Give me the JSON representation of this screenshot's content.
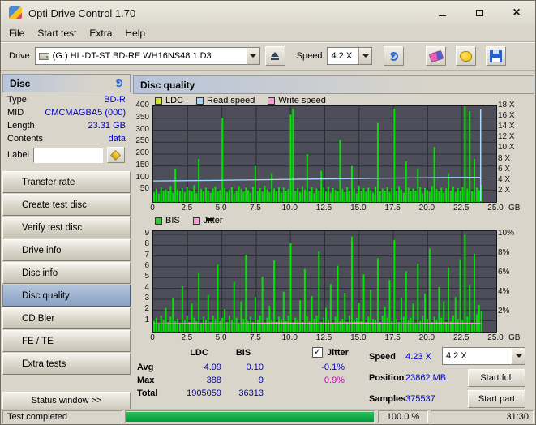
{
  "window": {
    "title": "Opti Drive Control 1.70"
  },
  "menu": {
    "items": [
      "File",
      "Start test",
      "Extra",
      "Help"
    ]
  },
  "toolbar": {
    "drive_label": "Drive",
    "drive_value": "(G:)  HL-DT-ST BD-RE  WH16NS48 1.D3",
    "speed_label": "Speed",
    "speed_value": "4.2 X"
  },
  "sidebar": {
    "panel_title": "Disc",
    "info": [
      {
        "label": "Type",
        "value": "BD-R"
      },
      {
        "label": "MID",
        "value": "CMCMAGBA5 (000)"
      },
      {
        "label": "Length",
        "value": "23.31 GB"
      },
      {
        "label": "Contents",
        "value": "data"
      }
    ],
    "label_row": {
      "label": "Label",
      "value": ""
    },
    "buttons": [
      {
        "id": "transfer-rate",
        "label": "Transfer rate"
      },
      {
        "id": "create-test-disc",
        "label": "Create test disc"
      },
      {
        "id": "verify-test-disc",
        "label": "Verify test disc"
      },
      {
        "id": "drive-info",
        "label": "Drive info"
      },
      {
        "id": "disc-info",
        "label": "Disc info"
      },
      {
        "id": "disc-quality",
        "label": "Disc quality",
        "selected": true
      },
      {
        "id": "cd-bler",
        "label": "CD Bler"
      },
      {
        "id": "fe-te",
        "label": "FE / TE"
      },
      {
        "id": "extra-tests",
        "label": "Extra tests"
      }
    ],
    "status_button": "Status window >>"
  },
  "main": {
    "panel_title": "Disc quality"
  },
  "chart_data": [
    {
      "type": "bar",
      "name": "ldc-and-speed",
      "legend": [
        {
          "label": "LDC",
          "color": "#c9e636"
        },
        {
          "label": "Read speed",
          "color": "#a6d8ff"
        },
        {
          "label": "Write speed",
          "color": "#ff9ad5"
        }
      ],
      "x_axis": {
        "ticks": [
          "0",
          "2.5",
          "5.0",
          "7.5",
          "10.0",
          "12.5",
          "15.0",
          "17.5",
          "20.0",
          "22.5",
          "25.0"
        ],
        "unit": "GB",
        "max_gb": 25,
        "tested_range_gb": 23.86
      },
      "y_left": {
        "ticks": [
          400,
          350,
          300,
          250,
          200,
          150,
          100,
          50
        ],
        "max": 400
      },
      "y_right": {
        "ticks": [
          {
            "v": 18,
            "label": "18 X"
          },
          {
            "v": 16,
            "label": "16 X"
          },
          {
            "v": 14,
            "label": "14 X"
          },
          {
            "v": 12,
            "label": "12 X"
          },
          {
            "v": 10,
            "label": "10 X"
          },
          {
            "v": 8,
            "label": "8 X"
          },
          {
            "v": 6,
            "label": "6 X"
          },
          {
            "v": 4,
            "label": "4 X"
          },
          {
            "v": 2,
            "label": "2 X"
          }
        ],
        "max": 18
      },
      "bar_color": "#00e400",
      "value_max": 400,
      "values": [
        40,
        55,
        35,
        60,
        48,
        52,
        44,
        66,
        38,
        140,
        52,
        46,
        58,
        40,
        62,
        50,
        44,
        70,
        36,
        180,
        54,
        42,
        60,
        48,
        38,
        56,
        64,
        44,
        50,
        350,
        58,
        40,
        52,
        62,
        36,
        48,
        66,
        54,
        42,
        60,
        50,
        38,
        64,
        150,
        46,
        58,
        42,
        68,
        52,
        40,
        120,
        56,
        44,
        62,
        38,
        60,
        48,
        54,
        365,
        390,
        46,
        58,
        40,
        66,
        52,
        200,
        44,
        62,
        36,
        56,
        48,
        130,
        60,
        42,
        64,
        38,
        58,
        50,
        44,
        260,
        54,
        40,
        62,
        48,
        150,
        56,
        36,
        68,
        46,
        58,
        42,
        60,
        50,
        38,
        64,
        330,
        44,
        56,
        48,
        62,
        40,
        58,
        390,
        46,
        66,
        52,
        38,
        170,
        60,
        44,
        56,
        48,
        140,
        62,
        36,
        58,
        50,
        42,
        66,
        230,
        54,
        44,
        60,
        38,
        56,
        120,
        48,
        64,
        40,
        58,
        46,
        62,
        400,
        56,
        380,
        44,
        180,
        60,
        50,
        70
      ],
      "read_speed": {
        "color": "#a6d8ff",
        "points": [
          [
            0,
            3.95
          ],
          [
            2,
            4.0
          ],
          [
            4,
            4.05
          ],
          [
            6,
            4.12
          ],
          [
            8,
            4.18
          ],
          [
            10,
            4.25
          ],
          [
            12,
            4.32
          ],
          [
            14,
            4.38
          ],
          [
            16,
            4.45
          ],
          [
            18,
            4.5
          ],
          [
            20,
            4.55
          ],
          [
            22,
            4.6
          ],
          [
            23.86,
            4.63
          ]
        ],
        "end_spike_x": 23.86
      }
    },
    {
      "type": "bar",
      "name": "bis-and-jitter",
      "legend": [
        {
          "label": "BIS",
          "color": "#35c435"
        },
        {
          "label": "Jitter",
          "color": "#ff9ad5"
        }
      ],
      "x_axis": {
        "ticks": [
          "0",
          "2.5",
          "5.0",
          "7.5",
          "10.0",
          "12.5",
          "15.0",
          "17.5",
          "20.0",
          "22.5",
          "25.0"
        ],
        "unit": "GB",
        "max_gb": 25,
        "tested_range_gb": 23.86
      },
      "y_left": {
        "ticks": [
          9,
          8,
          7,
          6,
          5,
          4,
          3,
          2,
          1
        ],
        "max": 9.3
      },
      "y_right": {
        "ticks": [
          {
            "v": 10,
            "label": "10%"
          },
          {
            "v": 8,
            "label": "8%"
          },
          {
            "v": 6,
            "label": "6%"
          },
          {
            "v": 4,
            "label": "4%"
          },
          {
            "v": 2,
            "label": "2%"
          }
        ],
        "max": 10.33
      },
      "bar_color": "#00e400",
      "value_max": 9.3,
      "values": [
        1.0,
        1.3,
        0.8,
        1.5,
        1.1,
        2.2,
        0.9,
        1.4,
        3.1,
        1.0,
        1.2,
        0.8,
        4.2,
        1.1,
        1.5,
        0.9,
        2.6,
        1.3,
        1.0,
        5.5,
        0.8,
        1.4,
        1.1,
        3.4,
        0.9,
        1.5,
        1.2,
        6.2,
        1.0,
        1.3,
        2.1,
        0.9,
        1.5,
        1.1,
        4.6,
        1.3,
        0.8,
        2.8,
        1.2,
        7.1,
        1.0,
        1.4,
        0.9,
        3.2,
        1.1,
        1.5,
        5.1,
        0.8,
        1.3,
        2.4,
        1.1,
        6.6,
        0.9,
        1.4,
        1.2,
        3.7,
        1.0,
        1.5,
        8.2,
        0.8,
        1.3,
        1.1,
        2.9,
        0.9,
        5.8,
        1.4,
        1.0,
        3.3,
        1.2,
        1.5,
        7.4,
        0.9,
        1.3,
        2.2,
        1.1,
        4.4,
        0.8,
        1.4,
        6.1,
        1.0,
        1.2,
        3.6,
        0.9,
        1.5,
        8.8,
        1.1,
        1.3,
        2.7,
        1.0,
        5.3,
        0.8,
        1.4,
        3.9,
        1.2,
        1.1,
        6.8,
        0.9,
        1.5,
        2.3,
        1.3,
        4.8,
        1.0,
        8.5,
        1.2,
        0.9,
        3.1,
        1.4,
        5.6,
        1.1,
        1.3,
        2.6,
        0.8,
        6.3,
        1.0,
        1.5,
        3.5,
        1.2,
        7.7,
        0.9,
        1.4,
        1.1,
        4.1,
        1.3,
        2.8,
        0.9,
        5.9,
        1.0,
        1.5,
        3.2,
        1.2,
        6.7,
        1.1,
        9.0,
        1.4,
        4.3,
        0.8,
        7.2,
        1.6,
        2.5,
        1.9
      ],
      "jitter": {
        "color": "#ff9ad5",
        "points_pct": [
          [
            0,
            0.8
          ],
          [
            3,
            0.85
          ],
          [
            6,
            0.8
          ],
          [
            9,
            0.9
          ],
          [
            12,
            0.85
          ],
          [
            15,
            0.9
          ],
          [
            18,
            0.82
          ],
          [
            21,
            0.88
          ],
          [
            23.86,
            0.85
          ]
        ]
      }
    }
  ],
  "stats": {
    "col_headers": [
      "LDC",
      "BIS"
    ],
    "jitter_label": "Jitter",
    "jitter_checked": true,
    "rows": [
      {
        "label": "Avg",
        "ldc": "4.99",
        "bis": "0.10",
        "jitter": "-0.1%"
      },
      {
        "label": "Max",
        "ldc": "388",
        "bis": "9",
        "jitter": "0.9%"
      },
      {
        "label": "Total",
        "ldc": "1905059",
        "bis": "36313",
        "jitter": ""
      }
    ],
    "speed_label": "Speed",
    "speed_value": "4.23 X",
    "speed_select": "4.2 X",
    "position_label": "Position",
    "position_value": "23862 MB",
    "samples_label": "Samples",
    "samples_value": "375537",
    "start_full": "Start full",
    "start_part": "Start part"
  },
  "statusbar": {
    "status": "Test completed",
    "percent": "100.0 %",
    "time": "31:30",
    "progress_value": 100
  },
  "colors": {
    "value_text": "#0000cd",
    "jitter_max_value": "#cc00bb",
    "selected_nav": "#8aa2c4",
    "plot_background": "#4e4e5a",
    "bar_green": "#00e400",
    "progress_green": "#00a343"
  }
}
